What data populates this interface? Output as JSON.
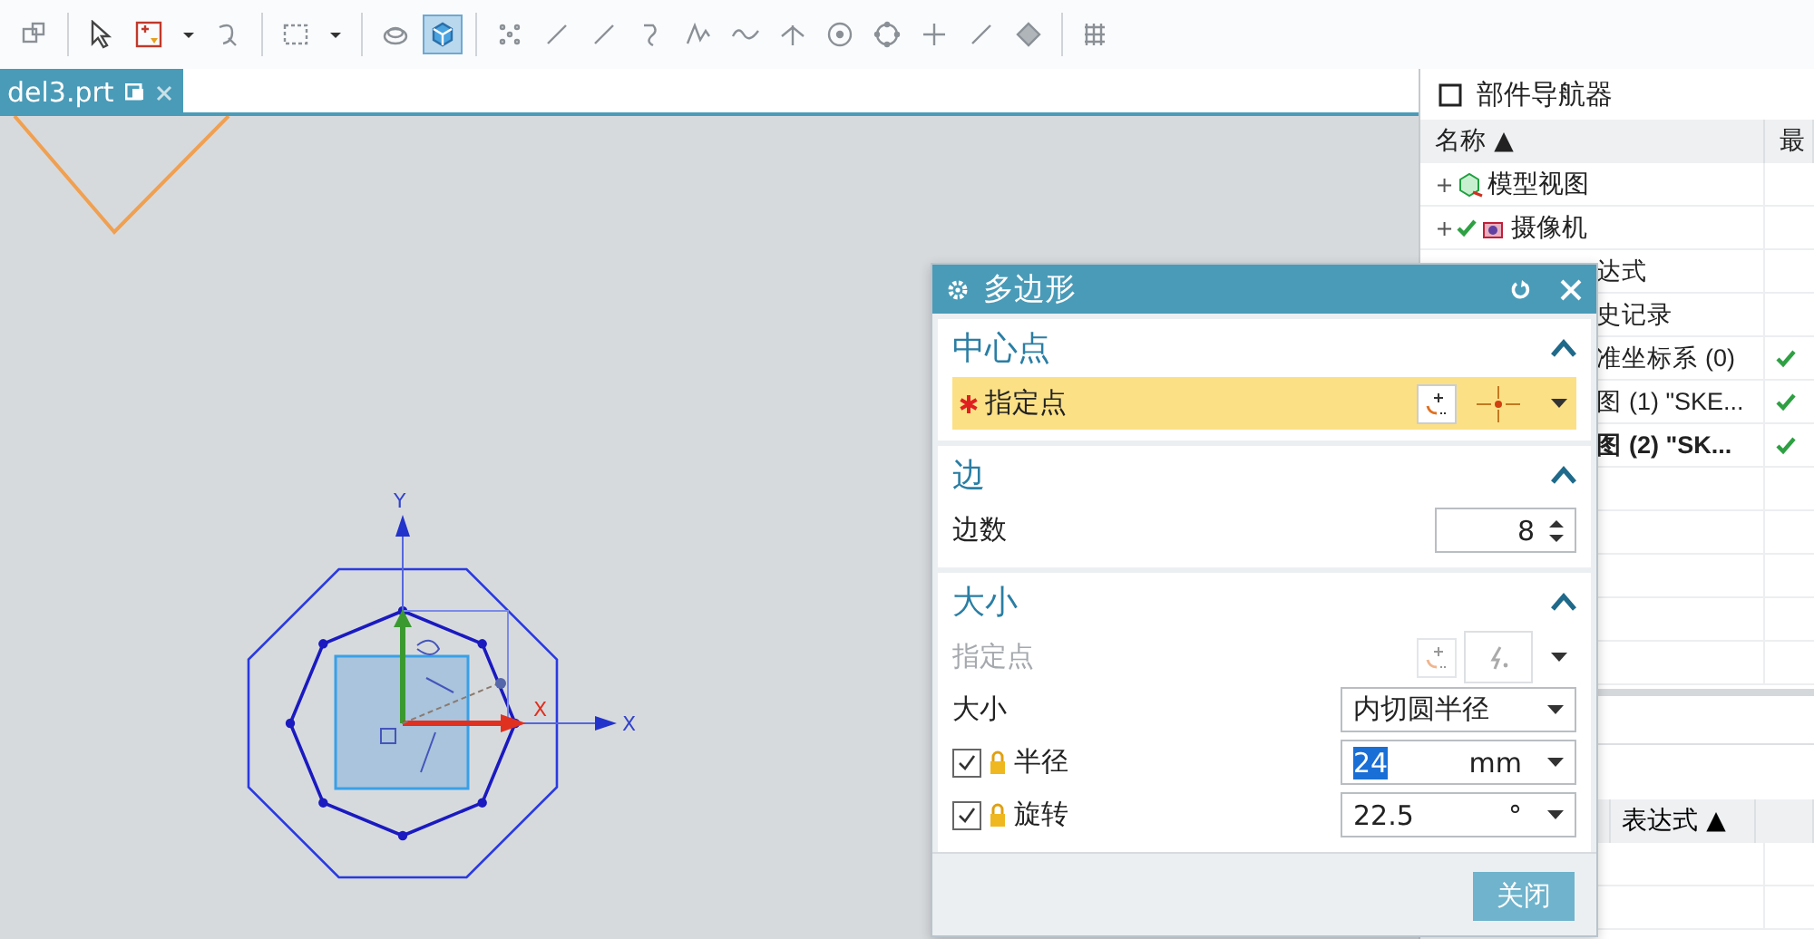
{
  "toolbar": [
    {
      "kind": "assembly",
      "selected": false
    },
    {
      "kind": "sep"
    },
    {
      "kind": "select",
      "selected": false
    },
    {
      "kind": "filter",
      "selected": false
    },
    {
      "kind": "caret",
      "selected": false
    },
    {
      "kind": "snap",
      "selected": false
    },
    {
      "kind": "sep"
    },
    {
      "kind": "rect-select",
      "selected": false
    },
    {
      "kind": "caret",
      "selected": false
    },
    {
      "kind": "sep"
    },
    {
      "kind": "shade",
      "selected": false
    },
    {
      "kind": "cube",
      "selected": true
    },
    {
      "kind": "sep"
    },
    {
      "kind": "points",
      "selected": false
    },
    {
      "kind": "line",
      "selected": false
    },
    {
      "kind": "line",
      "selected": false
    },
    {
      "kind": "hook",
      "selected": false
    },
    {
      "kind": "spline",
      "selected": false
    },
    {
      "kind": "wave",
      "selected": false
    },
    {
      "kind": "perp",
      "selected": false
    },
    {
      "kind": "circle-dot",
      "selected": false
    },
    {
      "kind": "circle",
      "selected": false
    },
    {
      "kind": "plus",
      "selected": false
    },
    {
      "kind": "line",
      "selected": false
    },
    {
      "kind": "diamond",
      "selected": false
    },
    {
      "kind": "sep"
    },
    {
      "kind": "grid",
      "selected": false
    }
  ],
  "tab": {
    "label": "del3.prt",
    "selected": true
  },
  "sketch": {
    "y_label": "Y",
    "x_label": "X",
    "x_handle_label": "X"
  },
  "navigator": {
    "title": "部件导航器",
    "columns": [
      "名称 ▲",
      "最"
    ],
    "rows": [
      {
        "kind": "view",
        "expander": "+",
        "checked": false,
        "label": "模型视图",
        "bold": false,
        "latest": false
      },
      {
        "kind": "camera",
        "expander": "+",
        "checked": true,
        "label": "摄像机",
        "bold": false,
        "latest": false
      },
      {
        "kind": "covered",
        "label": "达式",
        "bold": false,
        "latest": false
      },
      {
        "kind": "covered",
        "label": "史记录",
        "bold": false,
        "latest": false
      },
      {
        "kind": "covered",
        "label": "准坐标系 (0)",
        "bold": false,
        "latest": true
      },
      {
        "kind": "covered",
        "label": "图 (1) \"SKE...",
        "bold": false,
        "latest": true
      },
      {
        "kind": "covered",
        "label": "图 (2) \"SK...",
        "bold": true,
        "latest": true
      }
    ],
    "lower_columns": [
      "表达式 ▲"
    ]
  },
  "dialog": {
    "title": "多边形",
    "sections": [
      {
        "title": "中心点",
        "expanded": true,
        "rows": [
          {
            "kind": "point",
            "label": "指定点",
            "required": true,
            "active": true,
            "disabled": false
          }
        ]
      },
      {
        "title": "边",
        "expanded": true,
        "rows": [
          {
            "kind": "spinner",
            "label": "边数",
            "value": "8"
          }
        ]
      },
      {
        "title": "大小",
        "expanded": true,
        "rows": [
          {
            "kind": "point",
            "label": "指定点",
            "required": false,
            "active": false,
            "disabled": true
          },
          {
            "kind": "select",
            "label": "大小",
            "value": "内切圆半径"
          },
          {
            "kind": "measure",
            "label": "半径",
            "checked": true,
            "locked": true,
            "value": "24",
            "unit": "mm",
            "value_selected": true
          },
          {
            "kind": "measure",
            "label": "旋转",
            "checked": true,
            "locked": true,
            "value": "22.5",
            "unit": "°",
            "value_selected": false
          }
        ]
      }
    ],
    "close_button": {
      "label": "关闭"
    }
  }
}
